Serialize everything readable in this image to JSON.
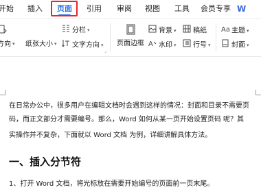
{
  "tabs": [
    {
      "label": "开始"
    },
    {
      "label": "插入"
    },
    {
      "label": "页面"
    },
    {
      "label": "引用"
    },
    {
      "label": "审阅"
    },
    {
      "label": "视图"
    },
    {
      "label": "工具"
    },
    {
      "label": "会员专享"
    }
  ],
  "active_tab": "页面",
  "brand_badge": "W",
  "ribbon": {
    "direction_partial": "方向",
    "paper_size": "纸张大小",
    "columns": "分栏",
    "text_direction": "文字方向",
    "page_border": "页面边框",
    "background": "背景",
    "watermark": "水印",
    "manuscript": "稿纸",
    "line_number": "行号",
    "theme": "主题",
    "cover": "封面"
  },
  "document": {
    "paragraph1_line1": "在日常办公中，很多用户在编辑文档时会遇到这样的情况：封面和目录不需要页",
    "paragraph1_line2": "码，而正文部分才需要编号。那么，Word 如何从某一页开始设置页码 呢？其",
    "paragraph1_line3": "实操作并不复杂，下面就以 Word 文档 为例，详细讲解具体方法。",
    "heading1": "一、插入分节符",
    "step1": "1、打开 Word 文档，将光标放在需要开始编号的页面前一页末尾。"
  },
  "colors": {
    "accent": "#2f6fe4",
    "highlight_box": "#e6252a"
  }
}
